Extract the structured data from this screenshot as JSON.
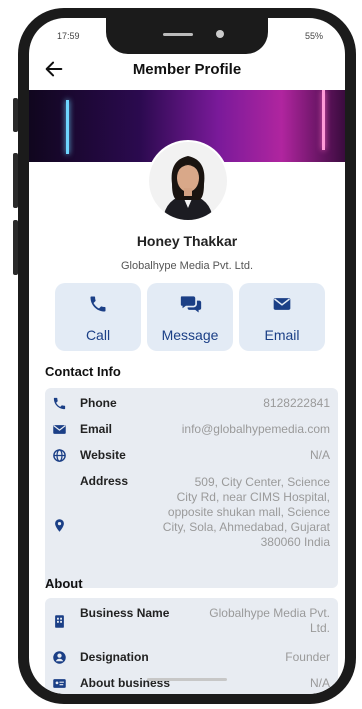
{
  "status_bar": {
    "time": "17:59",
    "right": "55%"
  },
  "header": {
    "title": "Member Profile"
  },
  "profile": {
    "name": "Honey Thakkar",
    "company": "Globalhype Media Pvt. Ltd."
  },
  "actions": [
    {
      "label": "Call",
      "icon": "phone-icon"
    },
    {
      "label": "Message",
      "icon": "chat-icon"
    },
    {
      "label": "Email",
      "icon": "envelope-icon"
    }
  ],
  "contact": {
    "title": "Contact Info",
    "phone_label": "Phone",
    "phone": "8128222841",
    "email_label": "Email",
    "email": "info@globalhypemedia.com",
    "website_label": "Website",
    "website": "N/A",
    "address_label": "Address",
    "address_lines": [
      "509, City Center, Science",
      "City Rd, near CIMS Hospital,",
      "opposite shukan mall, Science",
      "City, Sola, Ahmedabad, Gujarat",
      "380060 India"
    ]
  },
  "about": {
    "title": "About",
    "business_name_label": "Business Name",
    "business_name_lines": [
      "Globalhype Media Pvt.",
      "Ltd."
    ],
    "designation_label": "Designation",
    "designation": "Founder",
    "about_business_label": "About business",
    "about_business": "N/A"
  },
  "colors": {
    "accent": "#1b3f86",
    "action_bg": "#e3ebf5",
    "card_bg": "#e8ecf2"
  }
}
